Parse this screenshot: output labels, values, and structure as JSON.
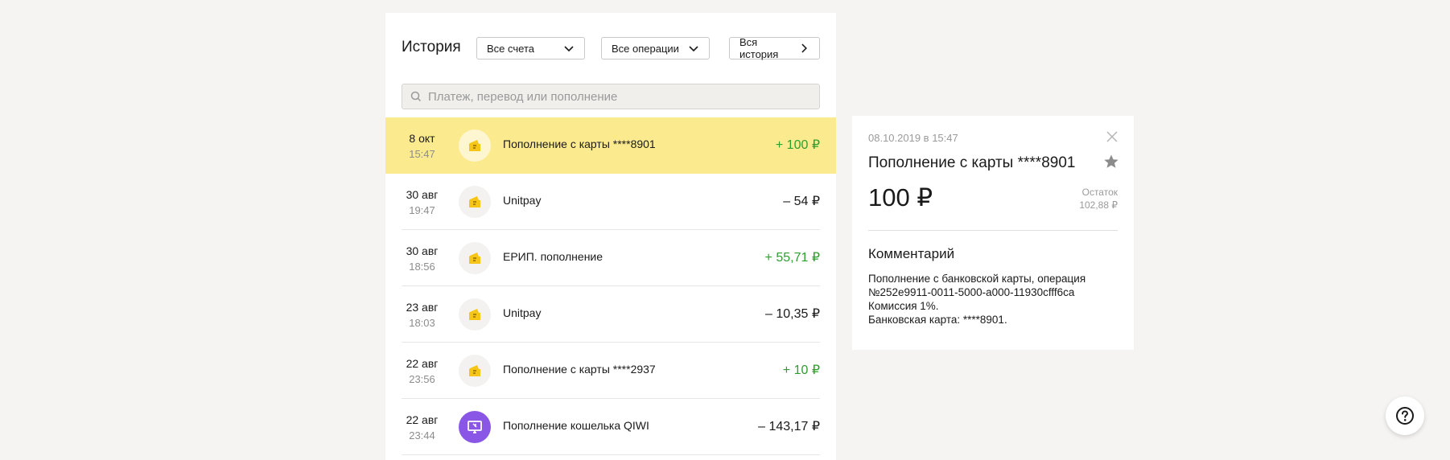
{
  "history": {
    "title": "История",
    "filters": {
      "accounts": "Все счета",
      "operations": "Все операции",
      "all_history": "Вся история"
    },
    "search_placeholder": "Платеж, перевод или пополнение",
    "rows": [
      {
        "date": "8 окт",
        "time": "15:47",
        "title": "Пополнение с карты ****8901",
        "amount": "+ 100 ₽",
        "type": "plus",
        "icon": "wallet-card-icon",
        "selected": true
      },
      {
        "date": "30 авг",
        "time": "19:47",
        "title": "Unitpay",
        "amount": "– 54 ₽",
        "type": "minus",
        "icon": "wallet-card-icon"
      },
      {
        "date": "30 авг",
        "time": "18:56",
        "title": "ЕРИП. пополнение",
        "amount": "+ 55,71 ₽",
        "type": "plus",
        "icon": "wallet-card-icon"
      },
      {
        "date": "23 авг",
        "time": "18:03",
        "title": "Unitpay",
        "amount": "– 10,35 ₽",
        "type": "minus",
        "icon": "wallet-card-icon"
      },
      {
        "date": "22 авг",
        "time": "23:56",
        "title": "Пополнение с карты ****2937",
        "amount": "+ 10 ₽",
        "type": "plus",
        "icon": "wallet-card-icon"
      },
      {
        "date": "22 авг",
        "time": "23:44",
        "title": "Пополнение кошелька QIWI",
        "amount": "– 143,17 ₽",
        "type": "minus",
        "icon": "terminal-icon"
      }
    ]
  },
  "detail": {
    "datetime": "08.10.2019 в 15:47",
    "title": "Пополнение с карты ****8901",
    "amount": "100 ₽",
    "balance_label": "Остаток",
    "balance_value": "102,88 ₽",
    "comment_heading": "Комментарий",
    "comment_lines": [
      "Пополнение с банковской карты, операция",
      "№252e9911-0011-5000-a000-11930cfff6ca",
      "Комиссия 1%.",
      "Банковская карта: ****8901."
    ]
  },
  "colors": {
    "selected_row": "#fcea8f",
    "plus_amount": "#2e9e2e",
    "qiwi_purple": "#8a56e6",
    "wallet_yellow": "#f5c518"
  }
}
